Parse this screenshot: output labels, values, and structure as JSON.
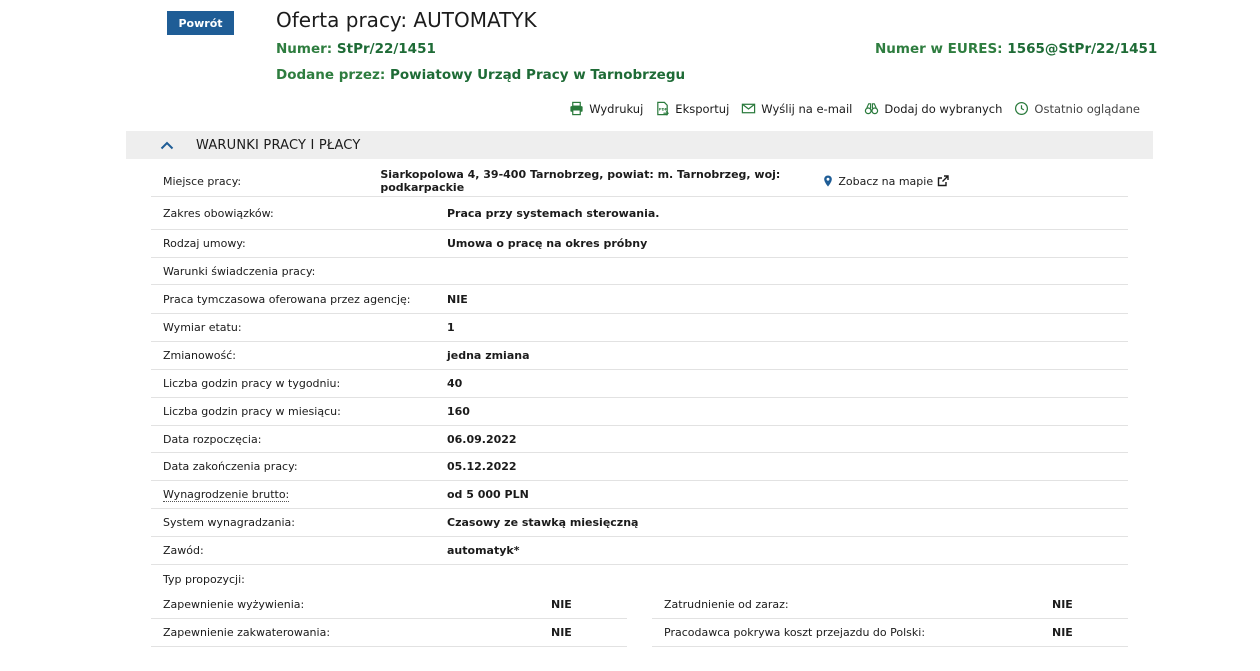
{
  "header": {
    "back_label": "Powrót",
    "title": "Oferta pracy: AUTOMATYK",
    "number_label": "Numer:",
    "number_value": "StPr/22/1451",
    "eures_label": "Numer w EURES:",
    "eures_value": "1565@StPr/22/1451",
    "added_label": "Dodane przez:",
    "added_value": "Powiatowy Urząd Pracy w Tarnobrzegu"
  },
  "toolbar": {
    "print": "Wydrukuj",
    "export": "Eksportuj",
    "email": "Wyślij na e-mail",
    "favorite": "Dodaj do wybranych",
    "recent": "Ostatnio oglądane"
  },
  "section": {
    "title": "WARUNKI PRACY I PŁACY"
  },
  "location": {
    "label": "Miejsce pracy:",
    "value": "Siarkopolowa 4, 39-400 Tarnobrzeg, powiat: m. Tarnobrzeg, woj: podkarpackie",
    "map_link": "Zobacz na mapie"
  },
  "rows": [
    {
      "label": "Zakres obowiązków:",
      "value": "Praca przy systemach sterowania."
    },
    {
      "label": "Rodzaj umowy:",
      "value": "Umowa o pracę na okres próbny"
    },
    {
      "label": "Warunki świadczenia pracy:",
      "value": ""
    },
    {
      "label": "Praca tymczasowa oferowana przez agencję:",
      "value": "NIE"
    },
    {
      "label": "Wymiar etatu:",
      "value": "1"
    },
    {
      "label": "Zmianowość:",
      "value": "jedna zmiana"
    },
    {
      "label": "Liczba godzin pracy w tygodniu:",
      "value": "40"
    },
    {
      "label": "Liczba godzin pracy w miesiącu:",
      "value": "160"
    },
    {
      "label": "Data rozpoczęcia:",
      "value": "06.09.2022"
    },
    {
      "label": "Data zakończenia pracy:",
      "value": "05.12.2022"
    },
    {
      "label": "Wynagrodzenie brutto:",
      "value": "od 5 000 PLN"
    },
    {
      "label": "System wynagradzania:",
      "value": "Czasowy ze stawką miesięczną"
    },
    {
      "label": "Zawód:",
      "value": "automatyk*"
    },
    {
      "label": "Typ propozycji:",
      "value": ""
    }
  ],
  "half_rows": [
    {
      "left": {
        "label": "Zapewnienie wyżywienia:",
        "value": "NIE"
      },
      "right": {
        "label": "Zatrudnienie od zaraz:",
        "value": "NIE"
      }
    },
    {
      "left": {
        "label": "Zapewnienie zakwaterowania:",
        "value": "NIE"
      },
      "right": {
        "label": "Pracodawca pokrywa koszt przejazdu do Polski:",
        "value": "NIE"
      }
    }
  ],
  "colors": {
    "accent": "#1f5d96",
    "meta_green": "#1e6b36",
    "icon_green": "#2a7a3c",
    "header_bg": "#eeeeee"
  }
}
